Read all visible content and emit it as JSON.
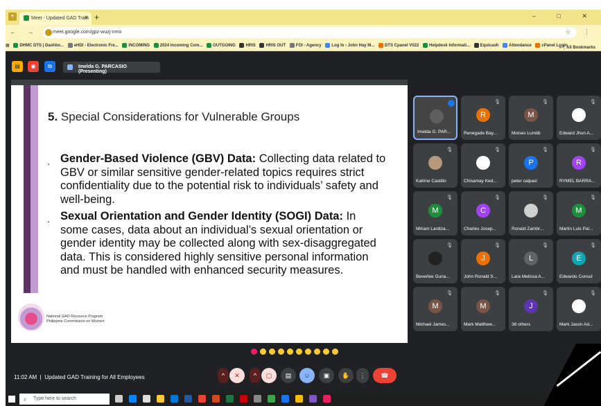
{
  "browser": {
    "tab_title": "Meet - Updated GAD Train",
    "tab_close": "✕",
    "new_tab": "+",
    "window_controls": "– □ ✕",
    "nav_buttons": "← → C",
    "url": "meet.google.com/gpz-wuzj-nmo",
    "addr_right": "☆ ⋮",
    "bookmarks": [
      "DHMC DTS | Dashbo...",
      "eHDI - Electronic Fre...",
      "INCOMING",
      "2024 Incoming Com...",
      "OUTGOING",
      "HRIS",
      "HRIS OUT",
      "FOI - Agency",
      "Log In ‹ John Hay M...",
      "DTS Cpanel V022",
      "Helpdesk Informati...",
      "Equicash",
      "Attendance",
      "cPanel Login"
    ],
    "bookmarks_more": "»",
    "all_bookmarks": "All Bookmarks"
  },
  "meet": {
    "presenting_label": "Imelda G. PARCASIO (Presenting)"
  },
  "slide": {
    "title_number": "5.",
    "title_text": " Special Considerations for Vulnerable Groups",
    "bullets": [
      {
        "heading": "Gender-Based Violence (GBV) Data:",
        "body": " Collecting data related to GBV or similar sensitive gender-related topics requires strict confidentiality due to the potential risk to individuals’ safety and well-being."
      },
      {
        "heading": "Sexual Orientation and Gender Identity (SOGI) Data:",
        "body": " In some cases, data about an individual’s sexual orientation or gender identity may be collected along with sex-disaggregated data. This is considered highly sensitive personal information and must be handled with enhanced security measures."
      }
    ],
    "org_line1": "National GAD Resource Program",
    "org_line2": "Philippine Commission on Women"
  },
  "participants": [
    {
      "name": "Imelda G. PAR...",
      "initial": "",
      "color": "#5f5f5f"
    },
    {
      "name": "Renegade Bay...",
      "initial": "R",
      "color": "#e8710a"
    },
    {
      "name": "Moises Lumiib",
      "initial": "M",
      "color": "#795548"
    },
    {
      "name": "Edward Jhun A...",
      "initial": "",
      "color": "#ffffff"
    },
    {
      "name": "Katrine Castillo",
      "initial": "",
      "color": "#b59a7a"
    },
    {
      "name": "Chisamay Ked...",
      "initial": "",
      "color": "#ffffff"
    },
    {
      "name": "peter calpasi",
      "initial": "P",
      "color": "#1a73e8"
    },
    {
      "name": "RYMEL BARRA...",
      "initial": "R",
      "color": "#a142f4"
    },
    {
      "name": "Miriam Lardiza...",
      "initial": "M",
      "color": "#1e8e3e"
    },
    {
      "name": "Charles Josep...",
      "initial": "C",
      "color": "#a142f4"
    },
    {
      "name": "Ronald Zambr...",
      "initial": "",
      "color": "#d0d0d0"
    },
    {
      "name": "Martin Luis Pal...",
      "initial": "M",
      "color": "#1e8e3e"
    },
    {
      "name": "Beverlee Guna...",
      "initial": "",
      "color": "#222222"
    },
    {
      "name": "John Ronald S...",
      "initial": "J",
      "color": "#e8710a"
    },
    {
      "name": "Lara Melissa A...",
      "initial": "L",
      "color": "#5f6368"
    },
    {
      "name": "Edwardo Consul",
      "initial": "E",
      "color": "#12a4af"
    },
    {
      "name": "Michael James...",
      "initial": "M",
      "color": "#795548"
    },
    {
      "name": "Mark Matthew...",
      "initial": "M",
      "color": "#795548"
    },
    {
      "name": "38 others",
      "initial": "J",
      "color": "#5e35b1"
    },
    {
      "name": "Mark Jason Ad...",
      "initial": "",
      "color": "#ffffff"
    }
  ],
  "bottom": {
    "time": "11:02 AM",
    "meeting_title": "Updated GAD Training for All Employees"
  },
  "taskbar": {
    "search_placeholder": "Type here to search"
  },
  "colors": {
    "accent_purple": "#5c3566",
    "end_call": "#ea4335",
    "meet_bg": "#202124"
  }
}
